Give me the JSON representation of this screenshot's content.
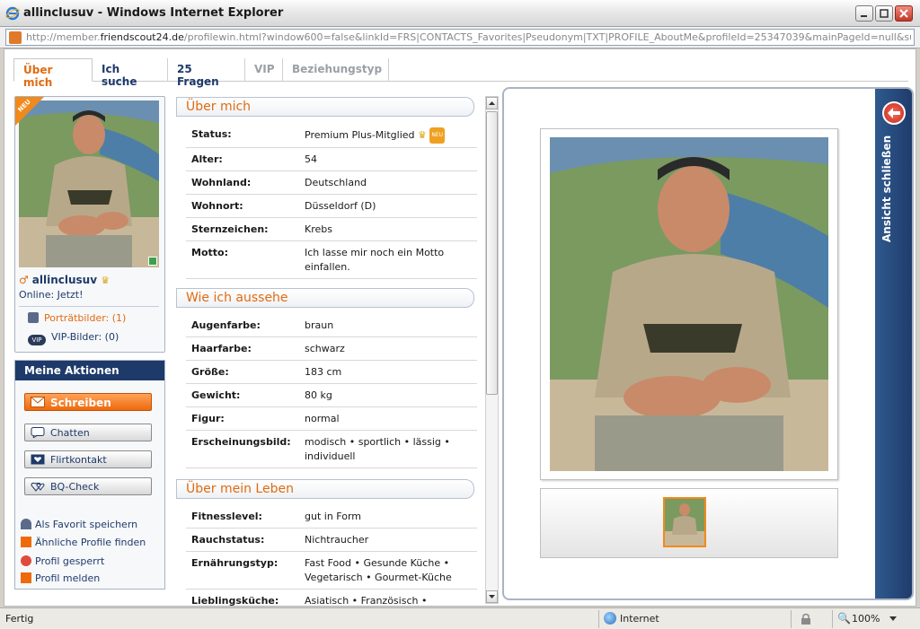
{
  "window": {
    "title": "allinclusuv - Windows Internet Explorer",
    "url_prefix": "http://member.",
    "url_domain": "friendscout24.de",
    "url_rest": "/profilewin.html?window600=false&linkId=FRS|CONTACTS_Favorites|Pseudonym|TXT|PROFILE_AboutMe&profileId=25347039&mainPageId=null&subPageId=null&ignoreCo"
  },
  "tabs": [
    {
      "label": "Über mich",
      "state": "active"
    },
    {
      "label": "Ich suche",
      "state": "normal"
    },
    {
      "label": "25 Fragen",
      "state": "normal"
    },
    {
      "label": "VIP",
      "state": "disabled"
    },
    {
      "label": "Beziehungstyp",
      "state": "disabled"
    }
  ],
  "profile": {
    "badge": "NEU",
    "username": "allinclusuv",
    "gender_symbol": "♂",
    "online": "Online: Jetzt!",
    "portrait_link": "Porträtbilder: (1)",
    "vip_link": "VIP-Bilder: (0)",
    "vip_badge": "VIP"
  },
  "actions": {
    "title": "Meine Aktionen",
    "buttons": [
      "Schreiben",
      "Chatten",
      "Flirtkontakt",
      "BQ-Check"
    ],
    "links": [
      "Als Favorit speichern",
      "Ähnliche Profile finden",
      "Profil gesperrt",
      "Profil melden"
    ]
  },
  "sections": {
    "about": {
      "title": "Über mich",
      "rows": [
        {
          "label": "Status:",
          "value": "Premium Plus-Mitglied"
        },
        {
          "label": "Alter:",
          "value": "54"
        },
        {
          "label": "Wohnland:",
          "value": "Deutschland"
        },
        {
          "label": "Wohnort:",
          "value": "Düsseldorf (D)"
        },
        {
          "label": "Sternzeichen:",
          "value": "Krebs"
        },
        {
          "label": "Motto:",
          "value": "Ich lasse mir noch ein Motto einfallen."
        }
      ],
      "status_badge": "NEU"
    },
    "looks": {
      "title": "Wie ich aussehe",
      "rows": [
        {
          "label": "Augenfarbe:",
          "value": "braun"
        },
        {
          "label": "Haarfarbe:",
          "value": "schwarz"
        },
        {
          "label": "Größe:",
          "value": "183 cm"
        },
        {
          "label": "Gewicht:",
          "value": "80 kg"
        },
        {
          "label": "Figur:",
          "value": "normal"
        },
        {
          "label": "Erscheinungsbild:",
          "value": "modisch  •  sportlich  •  lässig  •  individuell"
        }
      ]
    },
    "life": {
      "title": "Über mein Leben",
      "rows": [
        {
          "label": "Fitnesslevel:",
          "value": "gut in Form"
        },
        {
          "label": "Rauchstatus:",
          "value": "Nichtraucher"
        },
        {
          "label": "Ernährungstyp:",
          "value": "Fast Food  •  Gesunde Küche  •  Vegetarisch  •  Gourmet-Küche"
        },
        {
          "label": "Lieblingsküche:",
          "value": "Asiatisch  •  Französisch  •"
        }
      ]
    }
  },
  "viewer": {
    "close_label": "Ansicht schließen"
  },
  "status": {
    "text": "Fertig",
    "zone": "Internet",
    "zoom": "100%"
  },
  "colors": {
    "accent_orange": "#e06b10",
    "navy": "#1e3a6a"
  }
}
